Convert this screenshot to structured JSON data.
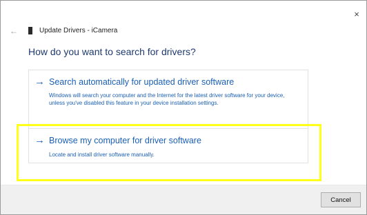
{
  "window": {
    "close_glyph": "×",
    "back_glyph": "←",
    "title": "Update Drivers - iCamera"
  },
  "heading": "How do you want to search for drivers?",
  "options": [
    {
      "arrow": "→",
      "title": "Search automatically for updated driver software",
      "description": "Windows will search your computer and the Internet for the latest driver software for your device, unless you've disabled this feature in your device installation settings."
    },
    {
      "arrow": "→",
      "title": "Browse my computer for driver software",
      "description": "Locate and install driver software manually."
    }
  ],
  "footer": {
    "cancel_label": "Cancel"
  },
  "colors": {
    "link": "#1a5fb4",
    "heading": "#1e3a6e",
    "highlight": "#ffff1a",
    "footer_bg": "#f0f0f0"
  },
  "icons": {
    "close": "close-icon",
    "back": "back-arrow-icon",
    "device": "device-icon",
    "option_arrow": "arrow-right-icon"
  }
}
